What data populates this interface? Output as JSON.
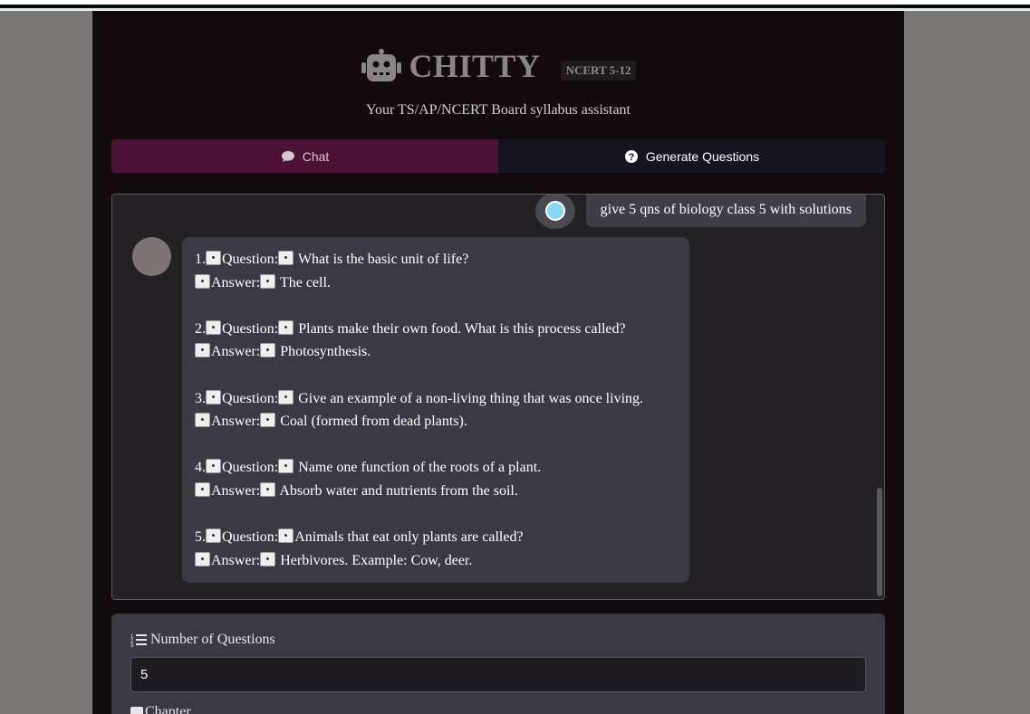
{
  "header": {
    "logo_icon": "robot-icon",
    "title": "CHITTY",
    "badge": "NCERT 5-12",
    "subtitle": "Your TS/AP/NCERT Board syllabus assistant"
  },
  "tabs": [
    {
      "label": "Chat",
      "icon": "chat-bubble-icon",
      "active": true
    },
    {
      "label": "Generate Questions",
      "icon": "question-circle-icon",
      "active": false
    }
  ],
  "chat": {
    "user_message": "give 5 qns of biology class 5 with solutions",
    "bot_reply": [
      {
        "num": "1.",
        "q_label": "Question:",
        "question": "What is the basic unit of life?",
        "a_label": "Answer:",
        "answer": "The cell."
      },
      {
        "num": "2.",
        "q_label": "Question:",
        "question": "Plants make their own food. What is this process called?",
        "a_label": "Answer:",
        "answer": "Photosynthesis."
      },
      {
        "num": "3.",
        "q_label": "Question:",
        "question": "Give an example of a non-living thing that was once living.",
        "a_label": "Answer:",
        "answer": "Coal (formed from dead plants)."
      },
      {
        "num": "4.",
        "q_label": "Question:",
        "question": "Name one function of the roots of a plant.",
        "a_label": "Answer:",
        "answer": "Absorb water and nutrients from the soil."
      },
      {
        "num": "5.",
        "q_label": "Question:",
        "question": "Animals that eat only plants are called?",
        "a_label": "Answer:",
        "answer": "Herbivores. Example: Cow, deer."
      }
    ]
  },
  "form": {
    "num_questions_label": "Number of Questions",
    "num_questions_value": "5",
    "next_label_partial": "Chapter"
  },
  "colors": {
    "app_bg": "#110b0d",
    "chat_tab": "#4b1236",
    "gen_tab": "#161421",
    "bubble": "#3b3a44"
  }
}
